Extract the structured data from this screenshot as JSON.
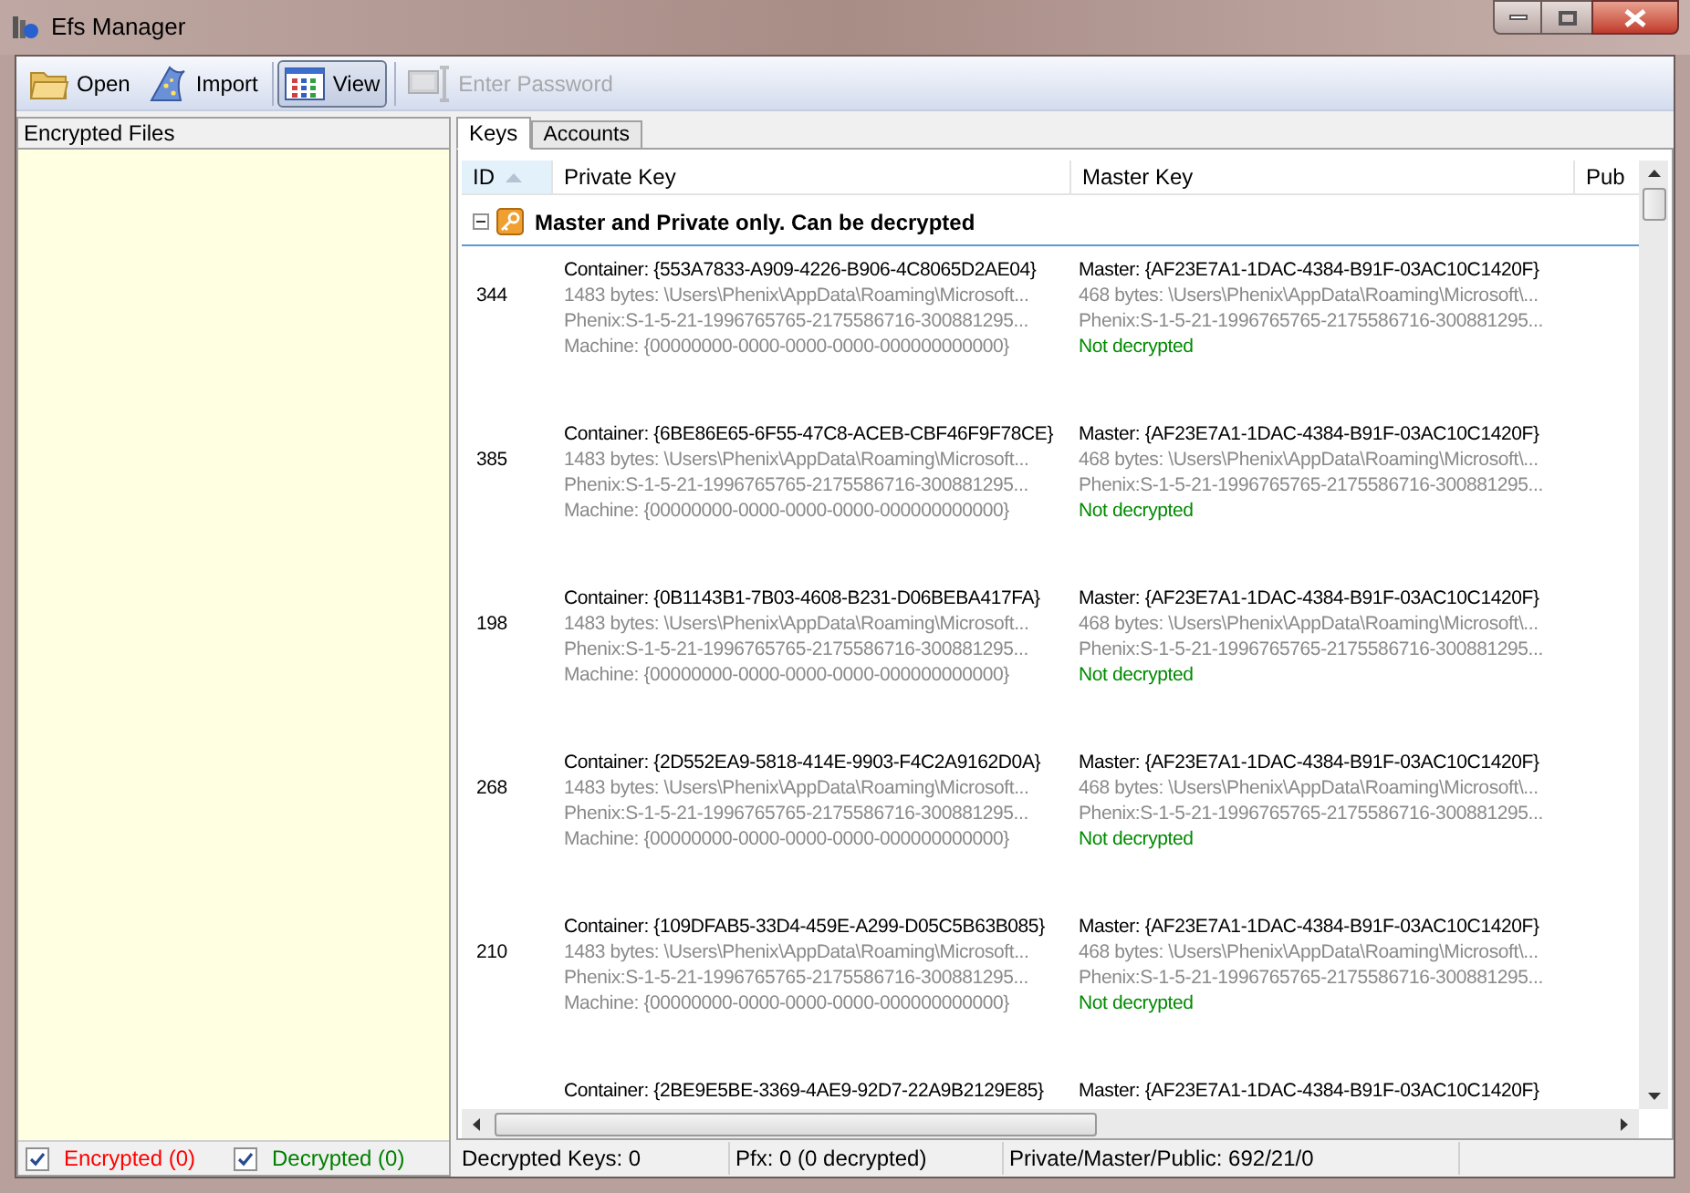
{
  "window": {
    "title": "Efs Manager"
  },
  "toolbar": [
    {
      "label": "Open",
      "kind": "folder",
      "selected": false,
      "disabled": false
    },
    {
      "label": "Import",
      "kind": "wizard",
      "selected": false,
      "disabled": false
    },
    {
      "label": "View",
      "kind": "grid",
      "selected": true,
      "disabled": false
    },
    {
      "label": "Enter Password",
      "kind": "terminal",
      "selected": false,
      "disabled": true
    }
  ],
  "left_panel": {
    "header": "Encrypted Files",
    "filters": [
      {
        "label": "Encrypted (0)",
        "checked": true,
        "color": "#ff0000"
      },
      {
        "label": "Decrypted (0)",
        "checked": true,
        "color": "#008000"
      }
    ]
  },
  "tabs": [
    {
      "label": "Keys",
      "selected": true
    },
    {
      "label": "Accounts",
      "selected": false
    }
  ],
  "columns": [
    {
      "label": "ID",
      "sorted": true
    },
    {
      "label": "Private Key",
      "sorted": false
    },
    {
      "label": "Master Key",
      "sorted": false
    },
    {
      "label": "Pub",
      "sorted": false
    }
  ],
  "group": {
    "label": "Master and Private only. Can be decrypted",
    "expanded": true
  },
  "rows": [
    {
      "id": "344",
      "private": [
        "Container: {553A7833-A909-4226-B906-4C8065D2AE04}",
        "1483 bytes: \\Users\\Phenix\\AppData\\Roaming\\Microsoft...",
        "Phenix:S-1-5-21-1996765765-2175586716-300881295...",
        "Machine: {00000000-0000-0000-0000-000000000000}"
      ],
      "master": [
        "Master: {AF23E7A1-1DAC-4384-B91F-03AC10C1420F}",
        "468 bytes: \\Users\\Phenix\\AppData\\Roaming\\Microsoft\\...",
        "Phenix:S-1-5-21-1996765765-2175586716-300881295...",
        "Not decrypted"
      ]
    },
    {
      "id": "385",
      "private": [
        "Container: {6BE86E65-6F55-47C8-ACEB-CBF46F9F78CE}",
        "1483 bytes: \\Users\\Phenix\\AppData\\Roaming\\Microsoft...",
        "Phenix:S-1-5-21-1996765765-2175586716-300881295...",
        "Machine: {00000000-0000-0000-0000-000000000000}"
      ],
      "master": [
        "Master: {AF23E7A1-1DAC-4384-B91F-03AC10C1420F}",
        "468 bytes: \\Users\\Phenix\\AppData\\Roaming\\Microsoft\\...",
        "Phenix:S-1-5-21-1996765765-2175586716-300881295...",
        "Not decrypted"
      ]
    },
    {
      "id": "198",
      "private": [
        "Container: {0B1143B1-7B03-4608-B231-D06BEBA417FA}",
        "1483 bytes: \\Users\\Phenix\\AppData\\Roaming\\Microsoft...",
        "Phenix:S-1-5-21-1996765765-2175586716-300881295...",
        "Machine: {00000000-0000-0000-0000-000000000000}"
      ],
      "master": [
        "Master: {AF23E7A1-1DAC-4384-B91F-03AC10C1420F}",
        "468 bytes: \\Users\\Phenix\\AppData\\Roaming\\Microsoft\\...",
        "Phenix:S-1-5-21-1996765765-2175586716-300881295...",
        "Not decrypted"
      ]
    },
    {
      "id": "268",
      "private": [
        "Container: {2D552EA9-5818-414E-9903-F4C2A9162D0A}",
        "1483 bytes: \\Users\\Phenix\\AppData\\Roaming\\Microsoft...",
        "Phenix:S-1-5-21-1996765765-2175586716-300881295...",
        "Machine: {00000000-0000-0000-0000-000000000000}"
      ],
      "master": [
        "Master: {AF23E7A1-1DAC-4384-B91F-03AC10C1420F}",
        "468 bytes: \\Users\\Phenix\\AppData\\Roaming\\Microsoft\\...",
        "Phenix:S-1-5-21-1996765765-2175586716-300881295...",
        "Not decrypted"
      ]
    },
    {
      "id": "210",
      "private": [
        "Container: {109DFAB5-33D4-459E-A299-D05C5B63B085}",
        "1483 bytes: \\Users\\Phenix\\AppData\\Roaming\\Microsoft...",
        "Phenix:S-1-5-21-1996765765-2175586716-300881295...",
        "Machine: {00000000-0000-0000-0000-000000000000}"
      ],
      "master": [
        "Master: {AF23E7A1-1DAC-4384-B91F-03AC10C1420F}",
        "468 bytes: \\Users\\Phenix\\AppData\\Roaming\\Microsoft\\...",
        "Phenix:S-1-5-21-1996765765-2175586716-300881295...",
        "Not decrypted"
      ]
    },
    {
      "id": "",
      "private": [
        "Container: {2BE9E5BE-3369-4AE9-92D7-22A9B2129E85}"
      ],
      "master": [
        "Master: {AF23E7A1-1DAC-4384-B91F-03AC10C1420F}"
      ]
    }
  ],
  "status_bar": [
    "Decrypted Keys: 0",
    "Pfx: 0 (0 decrypted)",
    "Private/Master/Public: 692/21/0"
  ]
}
